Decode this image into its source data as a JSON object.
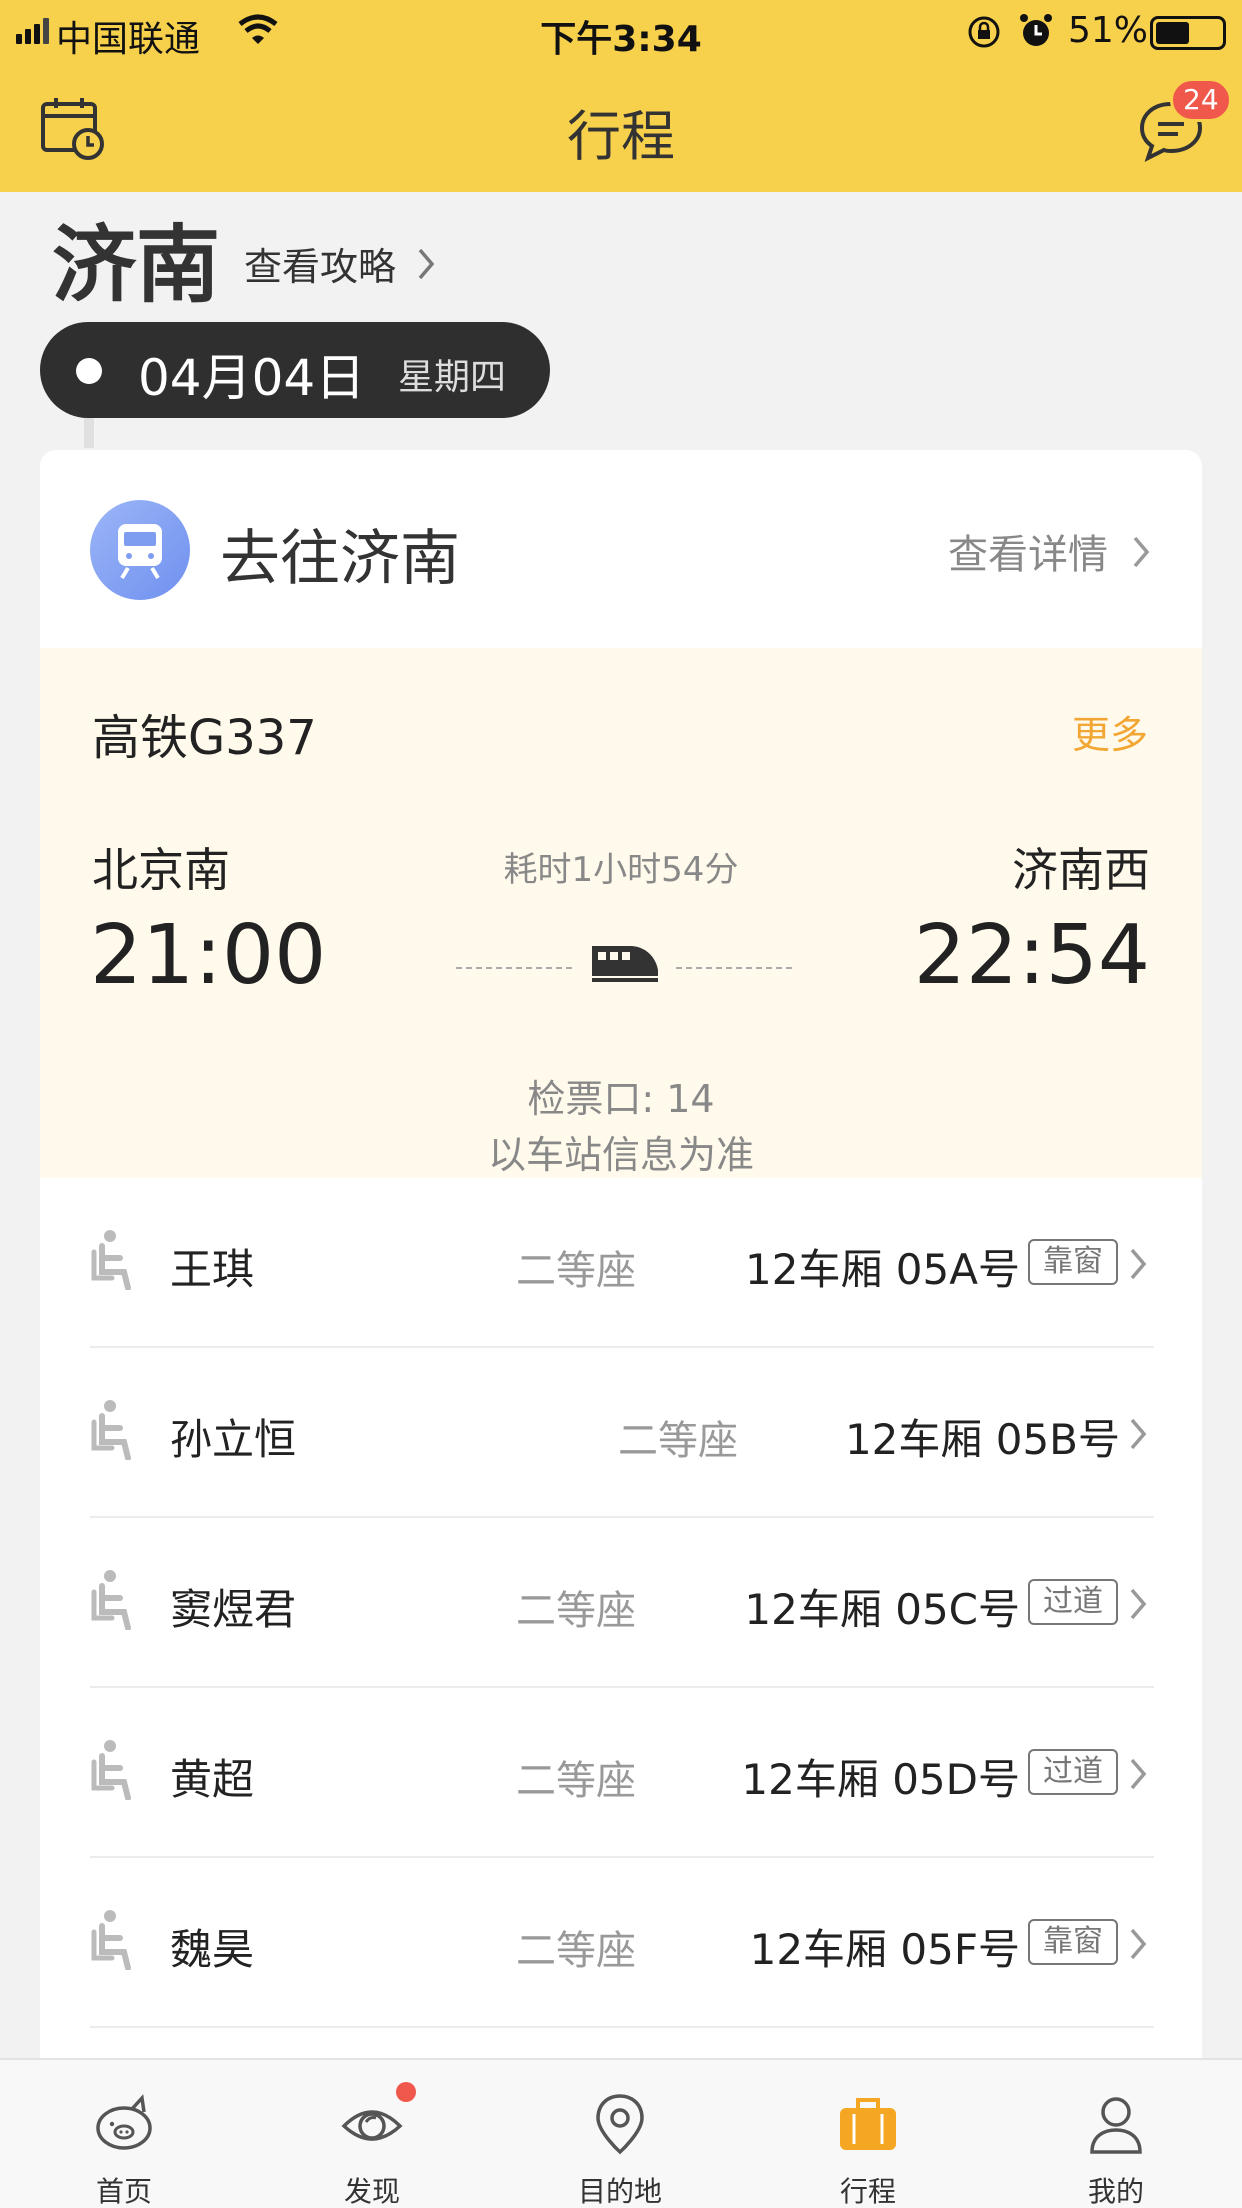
{
  "status_bar": {
    "carrier": "中国联通",
    "time": "下午3:34",
    "battery": "51%",
    "battery_level": 0.51
  },
  "header": {
    "title": "行程",
    "badge_count": "24"
  },
  "city": {
    "name": "济南",
    "guide_link": "查看攻略"
  },
  "date": {
    "date": "04月04日",
    "weekday": "星期四"
  },
  "trip": {
    "title": "去往济南",
    "detail_link": "查看详情",
    "train_name": "高铁G337",
    "more_label": "更多",
    "departure_station": "北京南",
    "departure_time": "21:00",
    "arrival_station": "济南西",
    "arrival_time": "22:54",
    "duration": "耗时1小时54分",
    "gate": "检票口: 14",
    "gate_note": "以车站信息为准"
  },
  "passengers": [
    {
      "name": "王琪",
      "class": "二等座",
      "seat": "12车厢 05A号",
      "tag": "靠窗"
    },
    {
      "name": "孙立恒",
      "class": "二等座",
      "seat": "12车厢 05B号",
      "tag": ""
    },
    {
      "name": "窦煜君",
      "class": "二等座",
      "seat": "12车厢 05C号",
      "tag": "过道"
    },
    {
      "name": "黄超",
      "class": "二等座",
      "seat": "12车厢 05D号",
      "tag": "过道"
    },
    {
      "name": "魏昊",
      "class": "二等座",
      "seat": "12车厢 05F号",
      "tag": "靠窗"
    }
  ],
  "tabs": [
    {
      "label": "首页",
      "icon": "pig-icon",
      "active": false
    },
    {
      "label": "发现",
      "icon": "eye-icon",
      "active": false,
      "dot": true
    },
    {
      "label": "目的地",
      "icon": "location-pin-icon",
      "active": false
    },
    {
      "label": "行程",
      "icon": "suitcase-icon",
      "active": true
    },
    {
      "label": "我的",
      "icon": "person-icon",
      "active": false
    }
  ],
  "colors": {
    "accent": "#f7d14c",
    "active_tab": "#f5a623",
    "badge": "#f0584c"
  }
}
